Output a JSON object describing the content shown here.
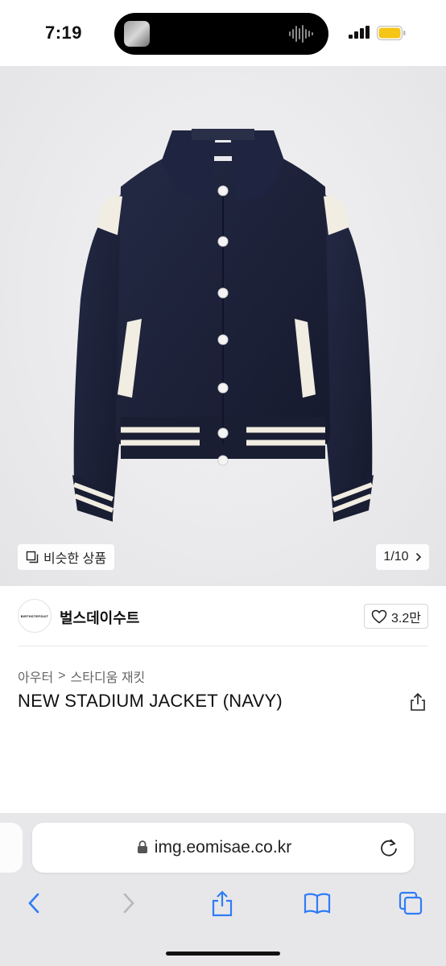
{
  "status_bar": {
    "time": "7:19"
  },
  "product_image": {
    "similar_label": "비슷한 상품",
    "page_counter": "1/10"
  },
  "brand": {
    "logo_text": "BIRTHSTEPSUIT",
    "name": "벌스데이수트",
    "likes": "3.2만"
  },
  "breadcrumb": {
    "category": "아우터",
    "separator": ">",
    "subcategory": "스타디움 재킷"
  },
  "product": {
    "title": "NEW STADIUM JACKET (NAVY)"
  },
  "browser": {
    "url": "img.eomisae.co.kr"
  },
  "colors": {
    "accent_blue": "#2f7cf6",
    "navy": "#1b1f36",
    "cream": "#f1ede2"
  },
  "icons": [
    "similar-items-icon",
    "chevron-right-icon",
    "heart-icon",
    "share-icon",
    "lock-icon",
    "reload-icon",
    "back-icon",
    "forward-icon",
    "share-icon",
    "bookmarks-icon",
    "tabs-icon"
  ]
}
